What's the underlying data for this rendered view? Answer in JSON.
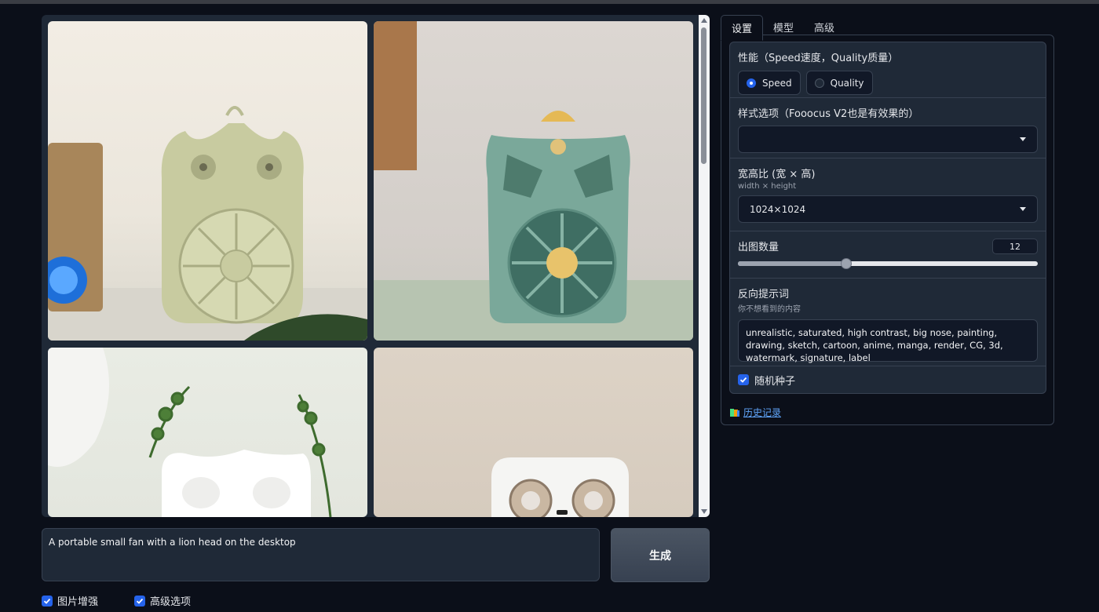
{
  "prompt": {
    "value": "A portable small fan with a lion head on the desktop"
  },
  "generate_label": "生成",
  "bottom_options": [
    {
      "label": "图片增强",
      "checked": true
    },
    {
      "label": "高级选项",
      "checked": true
    }
  ],
  "tabs": [
    {
      "label": "设置",
      "active": true
    },
    {
      "label": "模型",
      "active": false
    },
    {
      "label": "高级",
      "active": false
    }
  ],
  "performance": {
    "label": "性能（Speed速度，Quality质量）",
    "options": [
      {
        "label": "Speed",
        "selected": true
      },
      {
        "label": "Quality",
        "selected": false
      }
    ]
  },
  "style": {
    "label": "样式选项（Fooocus V2也是有效果的）",
    "value": ""
  },
  "aspect_ratio": {
    "label": "宽高比 (宽 × 高)",
    "sublabel": "width × height",
    "value": "1024×1024"
  },
  "image_count": {
    "label": "出图数量",
    "value": "12",
    "slider_fraction": 0.36
  },
  "negative_prompt": {
    "label": "反向提示词",
    "sublabel": "你不想看到的内容",
    "value": "unrealistic, saturated, high contrast, big nose, painting, drawing, sketch, cartoon, anime, manga, render, CG, 3d, watermark, signature, label"
  },
  "random_seed": {
    "label": "随机种子",
    "checked": true
  },
  "history_link": "历史记录",
  "icons": {
    "history": "book-icon",
    "checkbox": "checkmark-icon",
    "dropdown": "caret-down-icon"
  },
  "colors": {
    "accent": "#2563eb",
    "background": "#0b0f19",
    "panel": "#1f2937",
    "link": "#60a5fa"
  }
}
